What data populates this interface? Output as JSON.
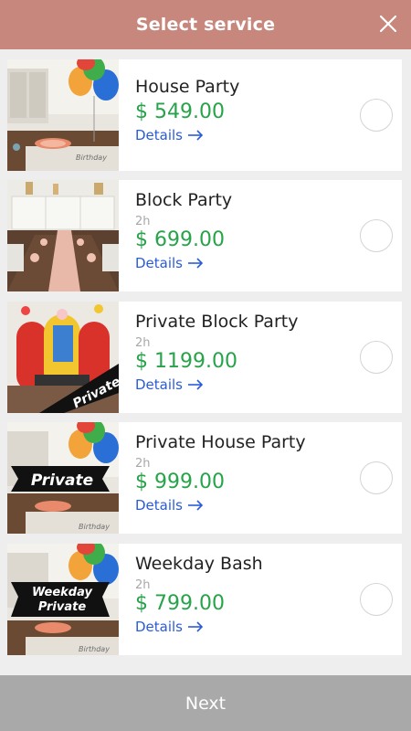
{
  "header": {
    "title": "Select service",
    "close_icon": "close-icon"
  },
  "services": [
    {
      "name": "House Party",
      "duration": "",
      "price": "$ 549.00",
      "details": "Details",
      "badge": ""
    },
    {
      "name": "Block Party",
      "duration": "2h",
      "price": "$ 699.00",
      "details": "Details",
      "badge": ""
    },
    {
      "name": "Private Block Party",
      "duration": "2h",
      "price": "$ 1199.00",
      "details": "Details",
      "badge": "Private"
    },
    {
      "name": "Private House Party",
      "duration": "2h",
      "price": "$ 999.00",
      "details": "Details",
      "badge": "Private"
    },
    {
      "name": "Weekday Bash",
      "duration": "2h",
      "price": "$ 799.00",
      "details": "Details",
      "badge": "Weekday Private"
    }
  ],
  "footer": {
    "next_label": "Next"
  },
  "colors": {
    "header_bg": "#c7877d",
    "price_green": "#27a34a",
    "link_blue": "#2a5bd7",
    "footer_bg": "#a9a9a9"
  }
}
